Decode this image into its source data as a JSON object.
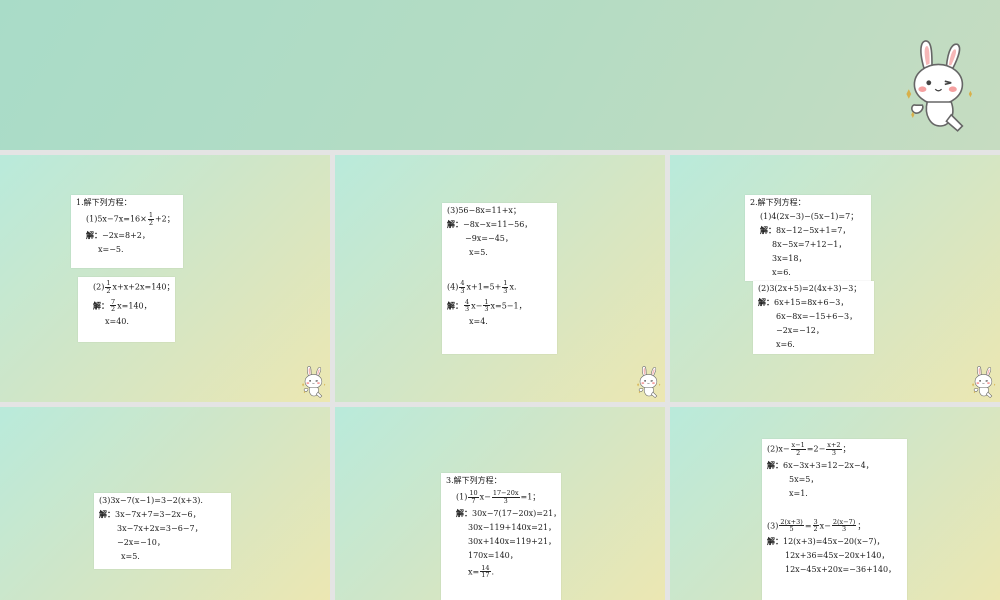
{
  "slides": {
    "s2": {
      "title": "1.解下列方程：",
      "p1": {
        "label": "(1)5x−7x=16×",
        "frac": {
          "n": "1",
          "d": "2"
        },
        "after": "+2；",
        "sol_prefix": "解：",
        "sol1": "−2x=8+2，",
        "sol2": "x=−5."
      },
      "p2": {
        "label": "(2)",
        "frac": {
          "n": "1",
          "d": "2"
        },
        "after": "x+x+2x=140；",
        "sol_prefix": "解：",
        "sol1_frac": {
          "n": "7",
          "d": "2"
        },
        "sol1": "x=140，",
        "sol2": "x=40."
      }
    },
    "s3": {
      "p3": {
        "label": "(3)56−8x=11+x；",
        "sol_prefix": "解：",
        "sol1": "−8x−x=11−56，",
        "sol2": "−9x=−45，",
        "sol3": "x=5."
      },
      "p4": {
        "label": "(4)",
        "frac1": {
          "n": "4",
          "d": "3"
        },
        "mid": "x+1=5+",
        "frac2": {
          "n": "1",
          "d": "3"
        },
        "after": "x.",
        "sol_prefix": "解：",
        "sol1_frac1": {
          "n": "4",
          "d": "3"
        },
        "sol1_mid": "x−",
        "sol1_frac2": {
          "n": "1",
          "d": "3"
        },
        "sol1_after": "x=5−1，",
        "sol2": "x=4."
      }
    },
    "s4": {
      "title": "2.解下列方程：",
      "p1": {
        "label": "(1)4(2x−3)−(5x−1)=7；",
        "sol_prefix": "解：",
        "sol1": "8x−12−5x+1=7，",
        "sol2": "8x−5x=7+12−1，",
        "sol3": "3x=18，",
        "sol4": "x=6."
      },
      "p2": {
        "label": "(2)3(2x+5)=2(4x+3)−3；",
        "sol_prefix": "解：",
        "sol1": "6x+15=8x+6−3，",
        "sol2": "6x−8x=−15+6−3，",
        "sol3": "−2x=−12，",
        "sol4": "x=6."
      }
    },
    "s5": {
      "p3": {
        "label": "(3)3x−7(x−1)=3−2(x+3).",
        "sol_prefix": "解：",
        "sol1": "3x−7x+7=3−2x−6，",
        "sol2": "3x−7x+2x=3−6−7，",
        "sol3": "−2x=−10，",
        "sol4": "x=5."
      }
    },
    "s6": {
      "title": "3.解下列方程：",
      "p1": {
        "label": "(1)",
        "frac1": {
          "n": "10",
          "d": "7"
        },
        "mid": "x−",
        "frac2": {
          "n": "17−20x",
          "d": "3"
        },
        "after": "=1；",
        "sol_prefix": "解：",
        "sol1": "30x−7(17−20x)=21，",
        "sol2": "30x−119+140x=21，",
        "sol3": "30x+140x=119+21，",
        "sol4": "170x=140，",
        "sol5_pre": "x=",
        "sol5_frac": {
          "n": "14",
          "d": "17"
        },
        "sol5_after": "."
      }
    },
    "s7": {
      "p2": {
        "label": "(2)x−",
        "frac1": {
          "n": "x−1",
          "d": "2"
        },
        "mid": "=2−",
        "frac2": {
          "n": "x+2",
          "d": "3"
        },
        "after": "；",
        "sol_prefix": "解：",
        "sol1": "6x−3x+3=12−2x−4，",
        "sol2": "5x=5，",
        "sol3": "x=1."
      },
      "p3": {
        "label": "(3)",
        "frac1": {
          "n": "2(x+3)",
          "d": "5"
        },
        "mid1": "=",
        "frac2": {
          "n": "3",
          "d": "2"
        },
        "mid2": "x−",
        "frac3": {
          "n": "2(x−7)",
          "d": "3"
        },
        "after": "；",
        "sol_prefix": "解：",
        "sol1": "12(x+3)=45x−20(x−7)，",
        "sol2": "12x+36=45x−20x+140，",
        "sol3": "12x−45x+20x=−36+140，"
      }
    }
  },
  "mascot_icon": "bunny-thumbs-up-icon",
  "colors": {
    "slide_teal": "#b9eadb",
    "slide_yellow": "#ece7b2",
    "card": "#ffffff"
  }
}
